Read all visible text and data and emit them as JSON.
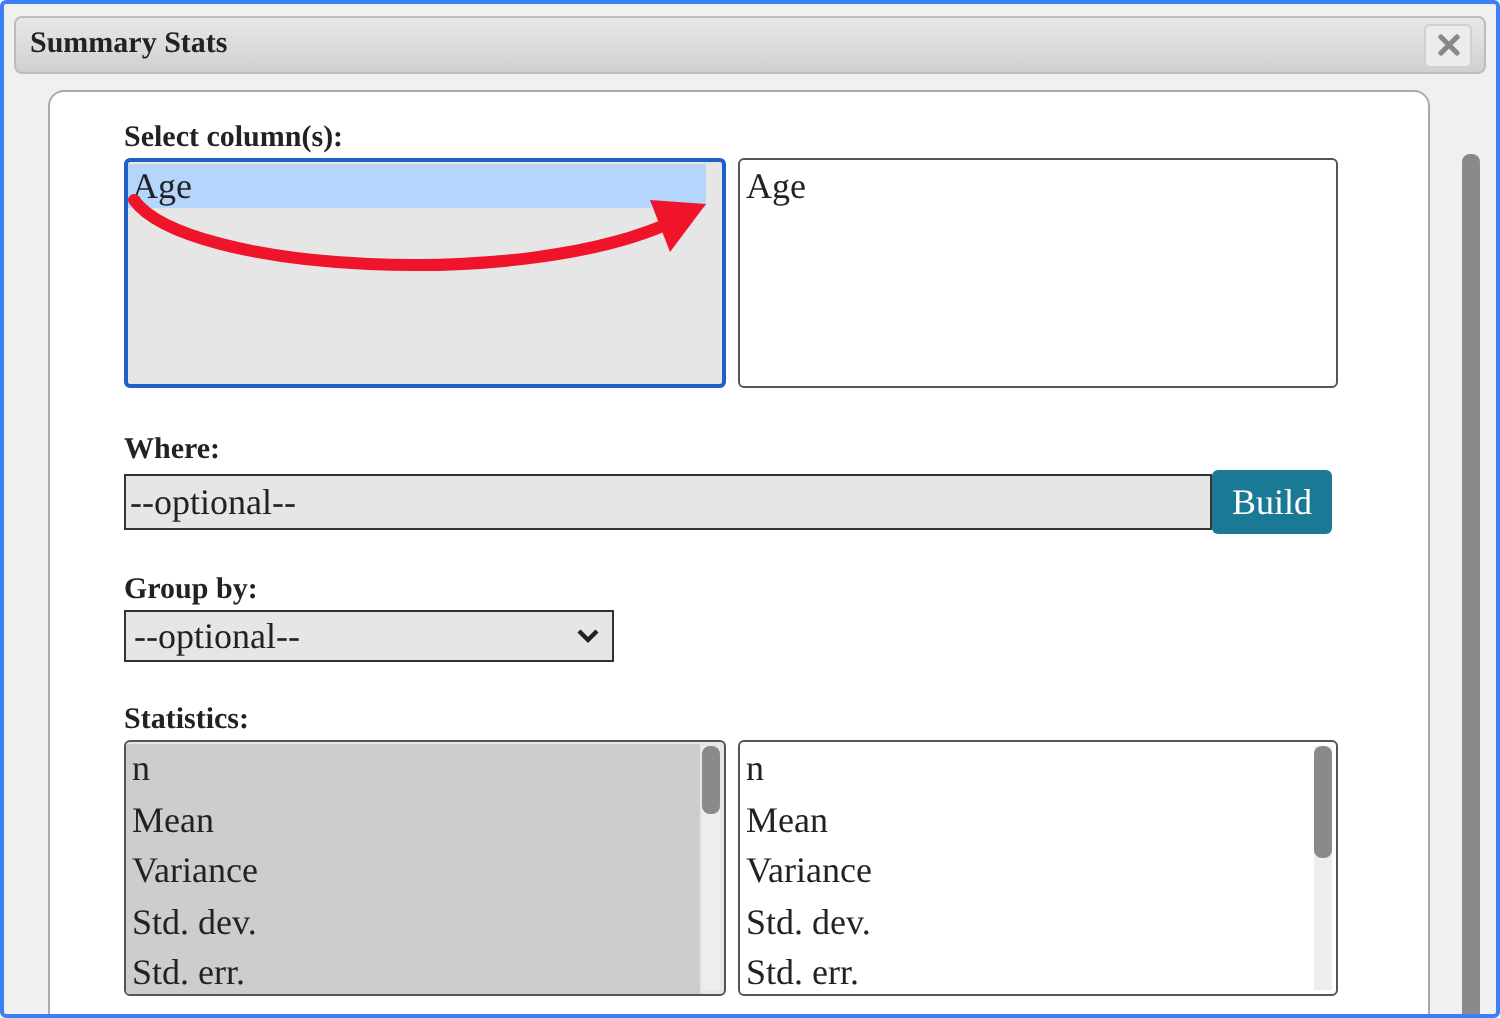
{
  "dialog": {
    "title": "Summary Stats"
  },
  "columns": {
    "label": "Select column(s):",
    "available": [
      {
        "label": "Age",
        "selected": true
      }
    ],
    "chosen": [
      {
        "label": "Age"
      }
    ]
  },
  "where": {
    "label": "Where:",
    "value": "--optional--",
    "button": "Build"
  },
  "group_by": {
    "label": "Group by:",
    "value": "--optional--"
  },
  "statistics": {
    "label": "Statistics:",
    "available": [
      {
        "label": "n",
        "selected": true
      },
      {
        "label": "Mean",
        "selected": true
      },
      {
        "label": "Variance",
        "selected": true
      },
      {
        "label": "Std. dev.",
        "selected": true
      },
      {
        "label": "Std. err.",
        "selected": true
      }
    ],
    "chosen": [
      {
        "label": "n"
      },
      {
        "label": "Mean"
      },
      {
        "label": "Variance"
      },
      {
        "label": "Std. dev."
      },
      {
        "label": "Std. err."
      }
    ]
  }
}
